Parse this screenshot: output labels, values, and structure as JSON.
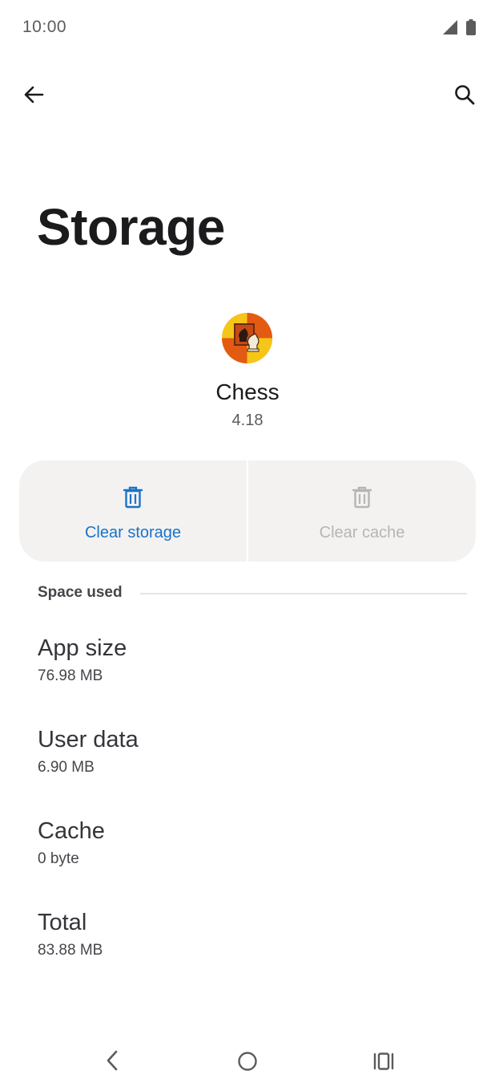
{
  "status_bar": {
    "time": "10:00",
    "icons": [
      "signal-icon",
      "battery-icon"
    ]
  },
  "app_bar": {
    "back_icon": "arrow-back-icon",
    "search_icon": "search-icon"
  },
  "page": {
    "title": "Storage"
  },
  "app": {
    "name": "Chess",
    "version": "4.18",
    "icon": "chess-app-icon"
  },
  "actions": {
    "clear_storage": {
      "label": "Clear storage",
      "icon": "trash-icon",
      "enabled": true
    },
    "clear_cache": {
      "label": "Clear cache",
      "icon": "trash-icon",
      "enabled": false
    }
  },
  "section": {
    "header": "Space used",
    "items": [
      {
        "title": "App size",
        "value": "76.98 MB"
      },
      {
        "title": "User data",
        "value": "6.90 MB"
      },
      {
        "title": "Cache",
        "value": "0 byte"
      },
      {
        "title": "Total",
        "value": "83.88 MB"
      }
    ]
  },
  "nav_bar": {
    "icons": [
      "nav-back-icon",
      "nav-home-icon",
      "nav-recents-icon"
    ]
  },
  "colors": {
    "accent": "#1a73c8",
    "card_bg": "#f3f2f1",
    "disabled": "#b5b5b5"
  }
}
